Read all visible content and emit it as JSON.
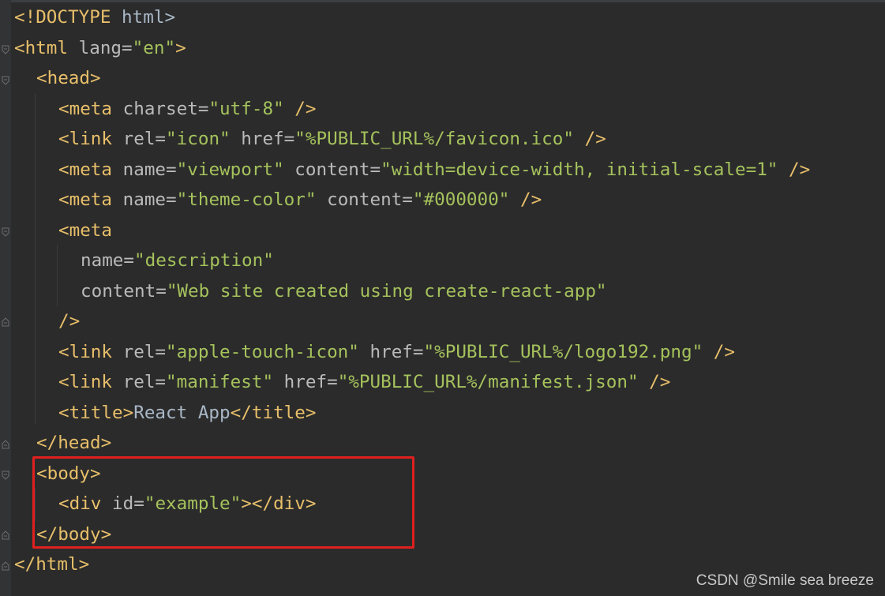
{
  "code": {
    "line1": {
      "open": "<!DOCTYPE",
      "rest": " html>"
    },
    "line2": {
      "tag_open": "<html",
      "attr": " lang=",
      "val": "\"en\"",
      "close": ">"
    },
    "line3": {
      "tag": "<head>"
    },
    "line4": {
      "tag_open": "<meta",
      "attr": " charset=",
      "val": "\"utf-8\"",
      "close": " />"
    },
    "line5": {
      "tag_open": "<link",
      "attr1": " rel=",
      "val1": "\"icon\"",
      "attr2": " href=",
      "val2": "\"%PUBLIC_URL%/favicon.ico\"",
      "close": " />"
    },
    "line6": {
      "tag_open": "<meta",
      "attr1": " name=",
      "val1": "\"viewport\"",
      "attr2": " content=",
      "val2": "\"width=device-width, initial-scale=1\"",
      "close": " />"
    },
    "line7": {
      "tag_open": "<meta",
      "attr1": " name=",
      "val1": "\"theme-color\"",
      "attr2": " content=",
      "val2": "\"#000000\"",
      "close": " />"
    },
    "line8": {
      "tag_open": "<meta"
    },
    "line9": {
      "attr": "name=",
      "val": "\"description\""
    },
    "line10": {
      "attr": "content=",
      "val": "\"Web site created using create-react-app\""
    },
    "line11": {
      "close": "/>"
    },
    "line12": {
      "tag_open": "<link",
      "attr1": " rel=",
      "val1": "\"apple-touch-icon\"",
      "attr2": " href=",
      "val2": "\"%PUBLIC_URL%/logo192.png\"",
      "close": " />"
    },
    "line13": {
      "tag_open": "<link",
      "attr1": " rel=",
      "val1": "\"manifest\"",
      "attr2": " href=",
      "val2": "\"%PUBLIC_URL%/manifest.json\"",
      "close": " />"
    },
    "line14": {
      "tag_open": "<title>",
      "text": "React App",
      "tag_close": "</title>"
    },
    "line15": {
      "tag": "</head>"
    },
    "line16": {
      "tag": "<body>"
    },
    "line17": {
      "tag_open": "<div",
      "attr": " id=",
      "val": "\"example\"",
      "close": "></div>"
    },
    "line18": {
      "tag": "</body>"
    },
    "line19": {
      "tag": "</html>"
    }
  },
  "watermark": "CSDN @Smile sea breeze",
  "colors": {
    "background": "#2b2b2b",
    "tag": "#e8bf6a",
    "attribute": "#bababa",
    "value": "#a5c25c",
    "text": "#a9b7c6",
    "highlight_border": "#e0201f"
  }
}
